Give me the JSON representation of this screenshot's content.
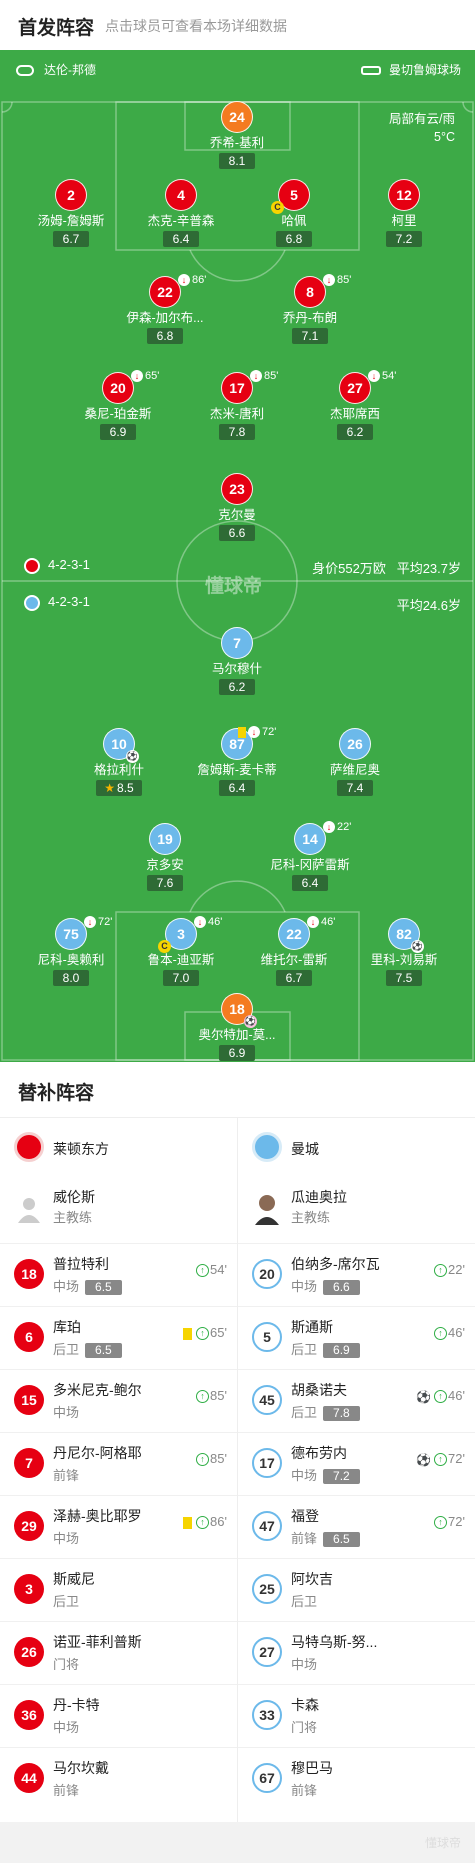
{
  "header": {
    "title": "首发阵容",
    "subtitle": "点击球员可查看本场详细数据"
  },
  "match": {
    "home_team": "达伦-邦德",
    "venue": "曼切鲁姆球场",
    "weather_line1": "局部有云/雨",
    "weather_line2": "5°C",
    "home_formation": "4-2-3-1",
    "home_value": "身价552万欧",
    "home_age": "平均23.7岁",
    "away_formation": "4-2-3-1",
    "away_age": "平均24.6岁",
    "watermark": "懂球帝"
  },
  "colors": {
    "home": "#e60012",
    "keeper": "#f47b20",
    "away": "#6cb9ea",
    "pitch": "#3daa47"
  },
  "home_players": [
    {
      "num": "24",
      "name": "乔希-基利",
      "rating": "8.1",
      "keeper": true
    },
    {
      "num": "2",
      "name": "汤姆-詹姆斯",
      "rating": "6.7"
    },
    {
      "num": "4",
      "name": "杰克-辛普森",
      "rating": "6.4"
    },
    {
      "num": "5",
      "name": "哈佩",
      "rating": "6.8",
      "captain": "C"
    },
    {
      "num": "12",
      "name": "柯里",
      "rating": "7.2"
    },
    {
      "num": "22",
      "name": "伊森-加尔布...",
      "rating": "6.8",
      "sub": "86'"
    },
    {
      "num": "8",
      "name": "乔丹-布朗",
      "rating": "7.1",
      "sub": "85'"
    },
    {
      "num": "20",
      "name": "桑尼-珀金斯",
      "rating": "6.9",
      "sub": "65'"
    },
    {
      "num": "17",
      "name": "杰米-唐利",
      "rating": "7.8",
      "sub": "85'"
    },
    {
      "num": "27",
      "name": "杰耶席西",
      "rating": "6.2",
      "sub": "54'"
    },
    {
      "num": "23",
      "name": "克尔曼",
      "rating": "6.6"
    }
  ],
  "away_players": [
    {
      "num": "7",
      "name": "马尔穆什",
      "rating": "6.2"
    },
    {
      "num": "10",
      "name": "格拉利什",
      "rating": "8.5",
      "star": true
    },
    {
      "num": "87",
      "name": "詹姆斯-麦卡蒂",
      "rating": "6.4",
      "sub": "72'"
    },
    {
      "num": "26",
      "name": "萨维尼奥",
      "rating": "7.4"
    },
    {
      "num": "19",
      "name": "京多安",
      "rating": "7.6"
    },
    {
      "num": "14",
      "name": "尼科-冈萨雷斯",
      "rating": "6.4",
      "sub": "22'"
    },
    {
      "num": "75",
      "name": "尼科-奥赖利",
      "rating": "8.0",
      "sub": "72'"
    },
    {
      "num": "3",
      "name": "鲁本-迪亚斯",
      "rating": "7.0",
      "sub": "46'",
      "captain": "C"
    },
    {
      "num": "22",
      "name": "维托尔-雷斯",
      "rating": "6.7",
      "sub": "46'"
    },
    {
      "num": "82",
      "name": "里科-刘易斯",
      "rating": "7.5"
    },
    {
      "num": "18",
      "name": "奥尔特加-莫...",
      "rating": "6.9",
      "keeper": true
    }
  ],
  "bench": {
    "title": "替补阵容",
    "home_team": "莱顿东方",
    "away_team": "曼城",
    "home_coach": {
      "name": "威伦斯",
      "role": "主教练"
    },
    "away_coach": {
      "name": "瓜迪奥拉",
      "role": "主教练"
    },
    "home": [
      {
        "num": "18",
        "name": "普拉特利",
        "pos": "中场",
        "rating": "6.5",
        "minute": "54'"
      },
      {
        "num": "6",
        "name": "库珀",
        "pos": "后卫",
        "rating": "6.5",
        "minute": "65'",
        "yellow": true
      },
      {
        "num": "15",
        "name": "多米尼克-鲍尔",
        "pos": "中场",
        "minute": "85'"
      },
      {
        "num": "7",
        "name": "丹尼尔-阿格耶",
        "pos": "前锋",
        "minute": "85'"
      },
      {
        "num": "29",
        "name": "泽赫-奥比耶罗",
        "pos": "中场",
        "minute": "86'",
        "yellow": true
      },
      {
        "num": "3",
        "name": "斯威尼",
        "pos": "后卫"
      },
      {
        "num": "26",
        "name": "诺亚-菲利普斯",
        "pos": "门将"
      },
      {
        "num": "36",
        "name": "丹-卡特",
        "pos": "中场"
      },
      {
        "num": "44",
        "name": "马尔坎戴",
        "pos": "前锋"
      }
    ],
    "away": [
      {
        "num": "20",
        "name": "伯纳多-席尔瓦",
        "pos": "中场",
        "rating": "6.6",
        "minute": "22'"
      },
      {
        "num": "5",
        "name": "斯通斯",
        "pos": "后卫",
        "rating": "6.9",
        "minute": "46'"
      },
      {
        "num": "45",
        "name": "胡桑诺夫",
        "pos": "后卫",
        "rating": "7.8",
        "minute": "46'",
        "goal": true
      },
      {
        "num": "17",
        "name": "德布劳内",
        "pos": "中场",
        "rating": "7.2",
        "minute": "72'",
        "goal": true
      },
      {
        "num": "47",
        "name": "福登",
        "pos": "前锋",
        "rating": "6.5",
        "minute": "72'"
      },
      {
        "num": "25",
        "name": "阿坎吉",
        "pos": "后卫"
      },
      {
        "num": "27",
        "name": "马特乌斯-努...",
        "pos": "中场"
      },
      {
        "num": "33",
        "name": "卡森",
        "pos": "门将"
      },
      {
        "num": "67",
        "name": "穆巴马",
        "pos": "前锋"
      }
    ]
  },
  "footer": {
    "watermark": "懂球帝"
  }
}
